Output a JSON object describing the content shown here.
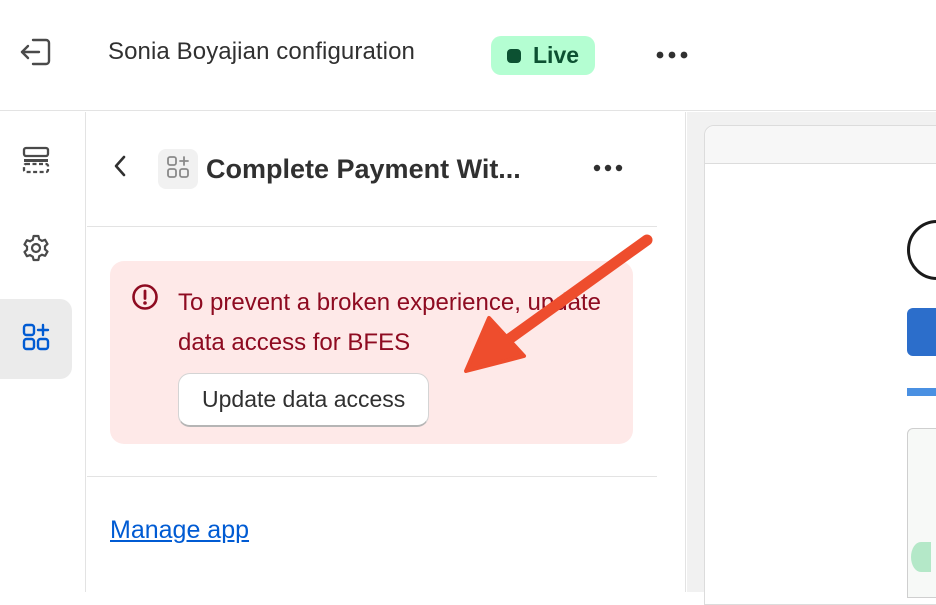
{
  "header": {
    "title": "Sonia Boyajian configuration",
    "status_badge": "Live",
    "exit_icon": "exit-icon",
    "more_icon": "more-horizontal-icon"
  },
  "sidebar": {
    "items": [
      {
        "icon": "sections-icon"
      },
      {
        "icon": "gear-icon"
      },
      {
        "icon": "apps-icon",
        "active": true
      }
    ]
  },
  "panel": {
    "title": "Complete Payment Wit...",
    "back_icon": "chevron-left-icon",
    "app_icon": "apps-icon",
    "more_icon": "more-horizontal-icon",
    "alert": {
      "text": "To prevent a broken experience, update data access for BFES",
      "button_label": "Update data access",
      "icon": "alert-circle-icon"
    },
    "manage_link": "Manage app"
  },
  "colors": {
    "badge_bg": "#b4fed2",
    "badge_text": "#0c5132",
    "alert_bg": "#fee9e8",
    "alert_text": "#8e0b21",
    "link": "#005bd3",
    "annotation_arrow": "#ee4d2d"
  }
}
